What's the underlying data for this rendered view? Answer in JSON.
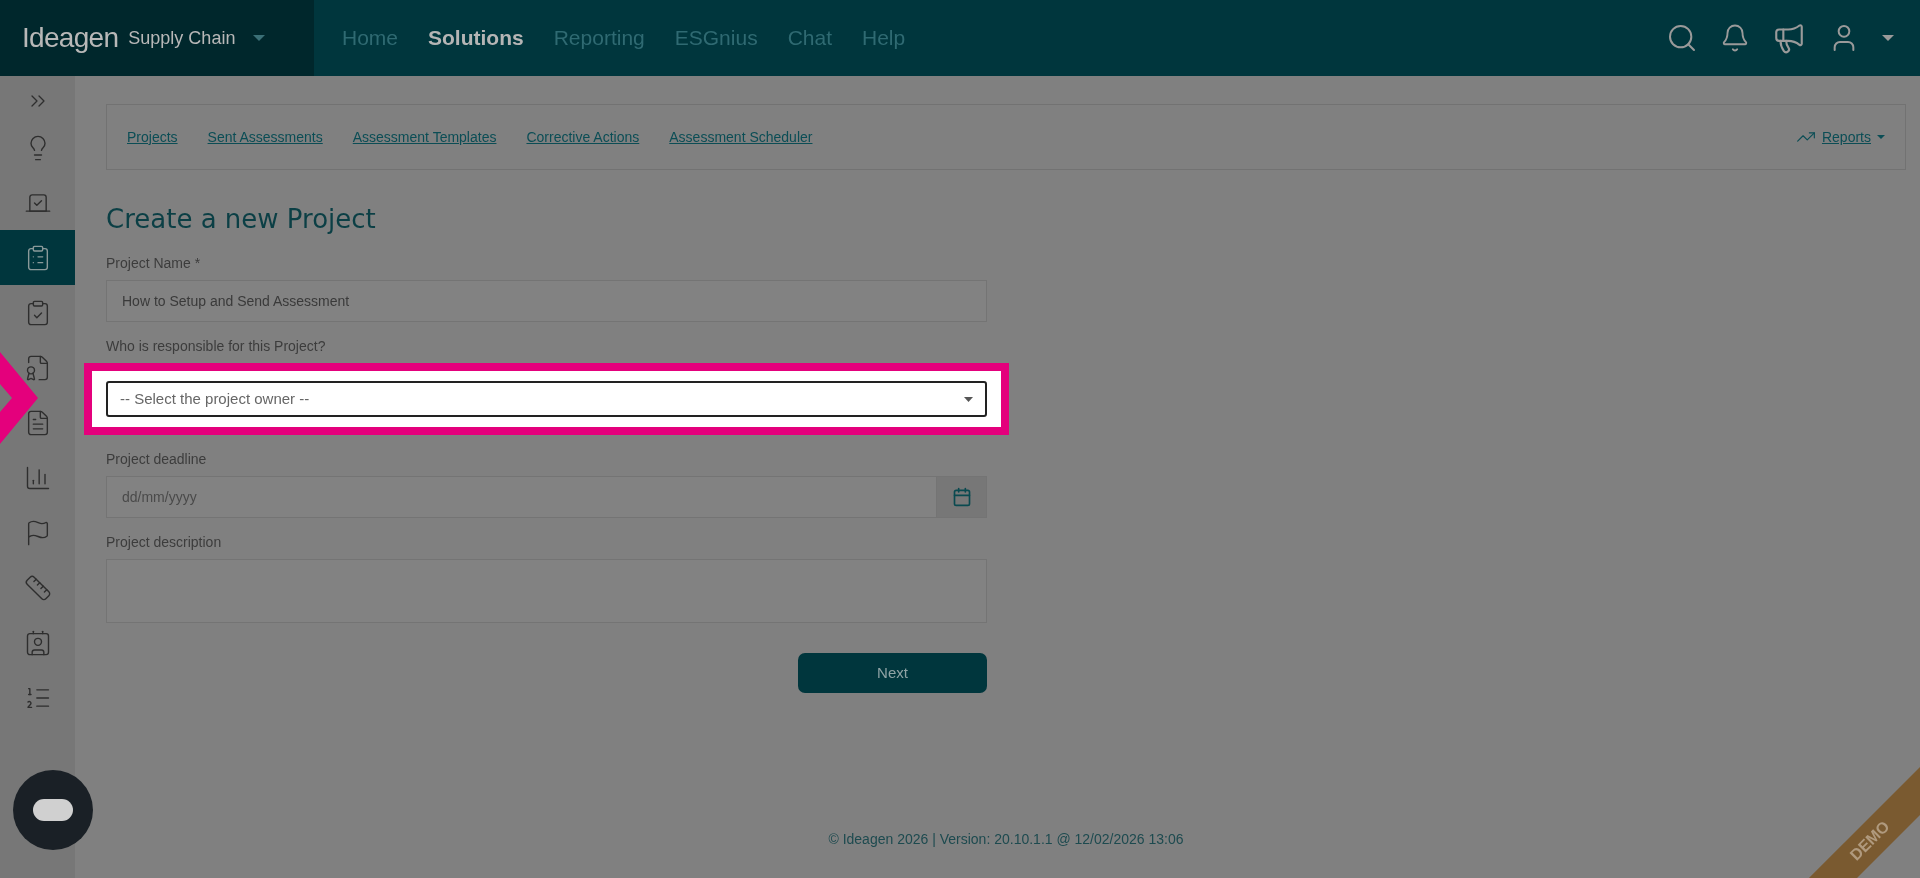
{
  "header": {
    "brand": "Ideagen",
    "product": "Supply Chain",
    "nav": [
      {
        "label": "Home",
        "selected": false
      },
      {
        "label": "Solutions",
        "selected": true
      },
      {
        "label": "Reporting",
        "selected": false
      },
      {
        "label": "ESGnius",
        "selected": false
      },
      {
        "label": "Chat",
        "selected": false
      },
      {
        "label": "Help",
        "selected": false
      }
    ]
  },
  "sidebar": {
    "items": [
      {
        "selected": false
      },
      {
        "selected": false
      },
      {
        "selected": true
      },
      {
        "selected": false
      },
      {
        "selected": false
      },
      {
        "selected": false
      },
      {
        "selected": false
      },
      {
        "selected": false
      },
      {
        "selected": false
      },
      {
        "selected": false
      },
      {
        "selected": false
      }
    ]
  },
  "subnav": {
    "links": [
      "Projects",
      "Sent Assessments",
      "Assessment Templates",
      "Corrective Actions",
      "Assessment Scheduler"
    ],
    "reports": "Reports"
  },
  "form": {
    "title": "Create a new Project",
    "fields": [
      {
        "kind": "text",
        "label": "Project Name *",
        "value": "How to Setup and Send Assessment",
        "highlighted": false
      },
      {
        "kind": "select",
        "label": "Who is responsible for this Project?",
        "placeholder": "-- Select the project owner --",
        "highlighted": true
      },
      {
        "kind": "date",
        "label": "Project deadline",
        "placeholder": "dd/mm/yyyy",
        "highlighted": false
      },
      {
        "kind": "textarea",
        "label": "Project description",
        "highlighted": false
      }
    ],
    "submit": "Next"
  },
  "footer": "© Ideagen 2026 | Version: 20.10.1.1 @ 12/02/2026 13:06",
  "ribbon": "DEMO"
}
